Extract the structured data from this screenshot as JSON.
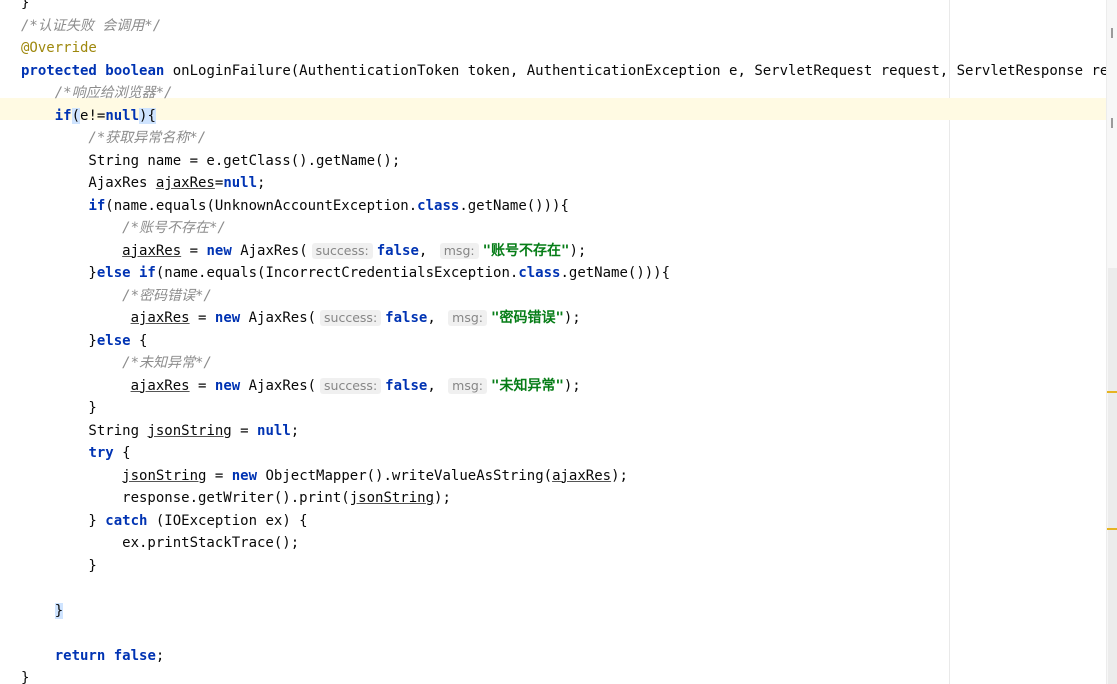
{
  "editor": {
    "lines": [
      [
        {
          "t": "}",
          "c": ""
        }
      ],
      [
        {
          "t": "/*认证失败 会调用*/",
          "c": "cm"
        }
      ],
      [
        {
          "t": "@Override",
          "c": "an"
        }
      ],
      [
        {
          "t": "protected",
          "c": "kw"
        },
        {
          "t": " ",
          "c": ""
        },
        {
          "t": "boolean",
          "c": "kw"
        },
        {
          "t": " onLoginFailure(AuthenticationToken token, AuthenticationException e, ServletRequest request, ServletResponse response) {",
          "c": ""
        }
      ],
      [
        {
          "t": "    /*响应给浏览器*/",
          "c": "cm"
        }
      ],
      [
        {
          "t": "    ",
          "c": ""
        },
        {
          "t": "if",
          "c": "kw"
        },
        {
          "t": "(",
          "c": "hl"
        },
        {
          "t": "e!=",
          "c": ""
        },
        {
          "t": "null",
          "c": "kw"
        },
        {
          "t": ")",
          "c": "hl"
        },
        {
          "t": "{",
          "c": "hl"
        }
      ],
      [
        {
          "t": "        /*获取异常名称*/",
          "c": "cm"
        }
      ],
      [
        {
          "t": "        String name = e.getClass().getName();",
          "c": ""
        }
      ],
      [
        {
          "t": "        AjaxRes ",
          "c": ""
        },
        {
          "t": "ajaxRes",
          "c": "ul"
        },
        {
          "t": "=",
          "c": ""
        },
        {
          "t": "null",
          "c": "kw"
        },
        {
          "t": ";",
          "c": ""
        }
      ],
      [
        {
          "t": "        ",
          "c": ""
        },
        {
          "t": "if",
          "c": "kw"
        },
        {
          "t": "(name.equals(UnknownAccountException.",
          "c": ""
        },
        {
          "t": "class",
          "c": "kw"
        },
        {
          "t": ".getName())){",
          "c": ""
        }
      ],
      [
        {
          "t": "            /*账号不存在*/",
          "c": "cm"
        }
      ],
      [
        {
          "t": "            ",
          "c": ""
        },
        {
          "t": "ajaxRes",
          "c": "ul"
        },
        {
          "t": " = ",
          "c": ""
        },
        {
          "t": "new",
          "c": "kw"
        },
        {
          "t": " AjaxRes(",
          "c": ""
        },
        {
          "t": "success:",
          "c": "hint"
        },
        {
          "t": "false",
          "c": "kw"
        },
        {
          "t": ", ",
          "c": ""
        },
        {
          "t": "msg:",
          "c": "hint"
        },
        {
          "t": "\"账号不存在\"",
          "c": "st"
        },
        {
          "t": ");",
          "c": ""
        }
      ],
      [
        {
          "t": "        }",
          "c": ""
        },
        {
          "t": "else if",
          "c": "kw"
        },
        {
          "t": "(name.equals(IncorrectCredentialsException.",
          "c": ""
        },
        {
          "t": "class",
          "c": "kw"
        },
        {
          "t": ".getName())){",
          "c": ""
        }
      ],
      [
        {
          "t": "            /*密码错误*/",
          "c": "cm"
        }
      ],
      [
        {
          "t": "             ",
          "c": ""
        },
        {
          "t": "ajaxRes",
          "c": "ul"
        },
        {
          "t": " = ",
          "c": ""
        },
        {
          "t": "new",
          "c": "kw"
        },
        {
          "t": " AjaxRes(",
          "c": ""
        },
        {
          "t": "success:",
          "c": "hint"
        },
        {
          "t": "false",
          "c": "kw"
        },
        {
          "t": ", ",
          "c": ""
        },
        {
          "t": "msg:",
          "c": "hint"
        },
        {
          "t": "\"密码错误\"",
          "c": "st"
        },
        {
          "t": ");",
          "c": ""
        }
      ],
      [
        {
          "t": "        }",
          "c": ""
        },
        {
          "t": "else",
          "c": "kw"
        },
        {
          "t": " {",
          "c": ""
        }
      ],
      [
        {
          "t": "            /*未知异常*/",
          "c": "cm"
        }
      ],
      [
        {
          "t": "             ",
          "c": ""
        },
        {
          "t": "ajaxRes",
          "c": "ul"
        },
        {
          "t": " = ",
          "c": ""
        },
        {
          "t": "new",
          "c": "kw"
        },
        {
          "t": " AjaxRes(",
          "c": ""
        },
        {
          "t": "success:",
          "c": "hint"
        },
        {
          "t": "false",
          "c": "kw"
        },
        {
          "t": ", ",
          "c": ""
        },
        {
          "t": "msg:",
          "c": "hint"
        },
        {
          "t": "\"未知异常\"",
          "c": "st"
        },
        {
          "t": ");",
          "c": ""
        }
      ],
      [
        {
          "t": "        }",
          "c": ""
        }
      ],
      [
        {
          "t": "        String ",
          "c": ""
        },
        {
          "t": "jsonString",
          "c": "ul"
        },
        {
          "t": " = ",
          "c": ""
        },
        {
          "t": "null",
          "c": "kw"
        },
        {
          "t": ";",
          "c": ""
        }
      ],
      [
        {
          "t": "        ",
          "c": ""
        },
        {
          "t": "try",
          "c": "kw"
        },
        {
          "t": " {",
          "c": ""
        }
      ],
      [
        {
          "t": "            ",
          "c": ""
        },
        {
          "t": "jsonString",
          "c": "ul"
        },
        {
          "t": " = ",
          "c": ""
        },
        {
          "t": "new",
          "c": "kw"
        },
        {
          "t": " ObjectMapper().writeValueAsString(",
          "c": ""
        },
        {
          "t": "ajaxRes",
          "c": "ul"
        },
        {
          "t": ");",
          "c": ""
        }
      ],
      [
        {
          "t": "            response.getWriter().print(",
          "c": ""
        },
        {
          "t": "jsonString",
          "c": "ul"
        },
        {
          "t": ");",
          "c": ""
        }
      ],
      [
        {
          "t": "        } ",
          "c": ""
        },
        {
          "t": "catch",
          "c": "kw"
        },
        {
          "t": " (IOException ex) {",
          "c": ""
        }
      ],
      [
        {
          "t": "            ex.printStackTrace();",
          "c": ""
        }
      ],
      [
        {
          "t": "        }",
          "c": ""
        }
      ],
      [
        {
          "t": "",
          "c": ""
        }
      ],
      [
        {
          "t": "    ",
          "c": ""
        },
        {
          "t": "}",
          "c": "hl"
        }
      ],
      [
        {
          "t": "",
          "c": ""
        }
      ],
      [
        {
          "t": "    ",
          "c": ""
        },
        {
          "t": "return",
          "c": "kw"
        },
        {
          "t": " ",
          "c": ""
        },
        {
          "t": "false",
          "c": "kw"
        },
        {
          "t": ";",
          "c": ""
        }
      ],
      [
        {
          "t": "}",
          "c": ""
        }
      ]
    ]
  }
}
